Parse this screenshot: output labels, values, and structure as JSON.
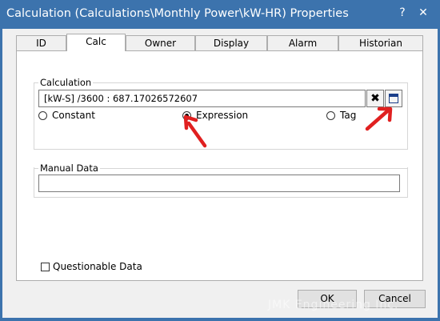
{
  "window": {
    "title": "Calculation (Calculations\\Monthly Power\\kW-HR) Properties",
    "help_label": "?",
    "close_label": "✕"
  },
  "tabs": [
    {
      "label": "ID"
    },
    {
      "label": "Calc"
    },
    {
      "label": "Owner"
    },
    {
      "label": "Display"
    },
    {
      "label": "Alarm"
    },
    {
      "label": "Historian"
    }
  ],
  "active_tab": "Calc",
  "calculation": {
    "legend": "Calculation",
    "expression": "[kW-S]    /3600 : 687.17026572607",
    "clear_label": "✖",
    "options": [
      {
        "label": "Constant",
        "selected": false
      },
      {
        "label": "Expression",
        "selected": true
      },
      {
        "label": "Tag",
        "selected": false
      }
    ]
  },
  "manual_data": {
    "legend": "Manual Data",
    "value": ""
  },
  "questionable": {
    "label": "Questionable Data",
    "checked": false
  },
  "buttons": {
    "ok": "OK",
    "cancel": "Cancel"
  },
  "watermark": "JMK Engineering Inc.",
  "colors": {
    "titlebar": "#3c73ad",
    "annotation_arrow": "#e02020"
  }
}
